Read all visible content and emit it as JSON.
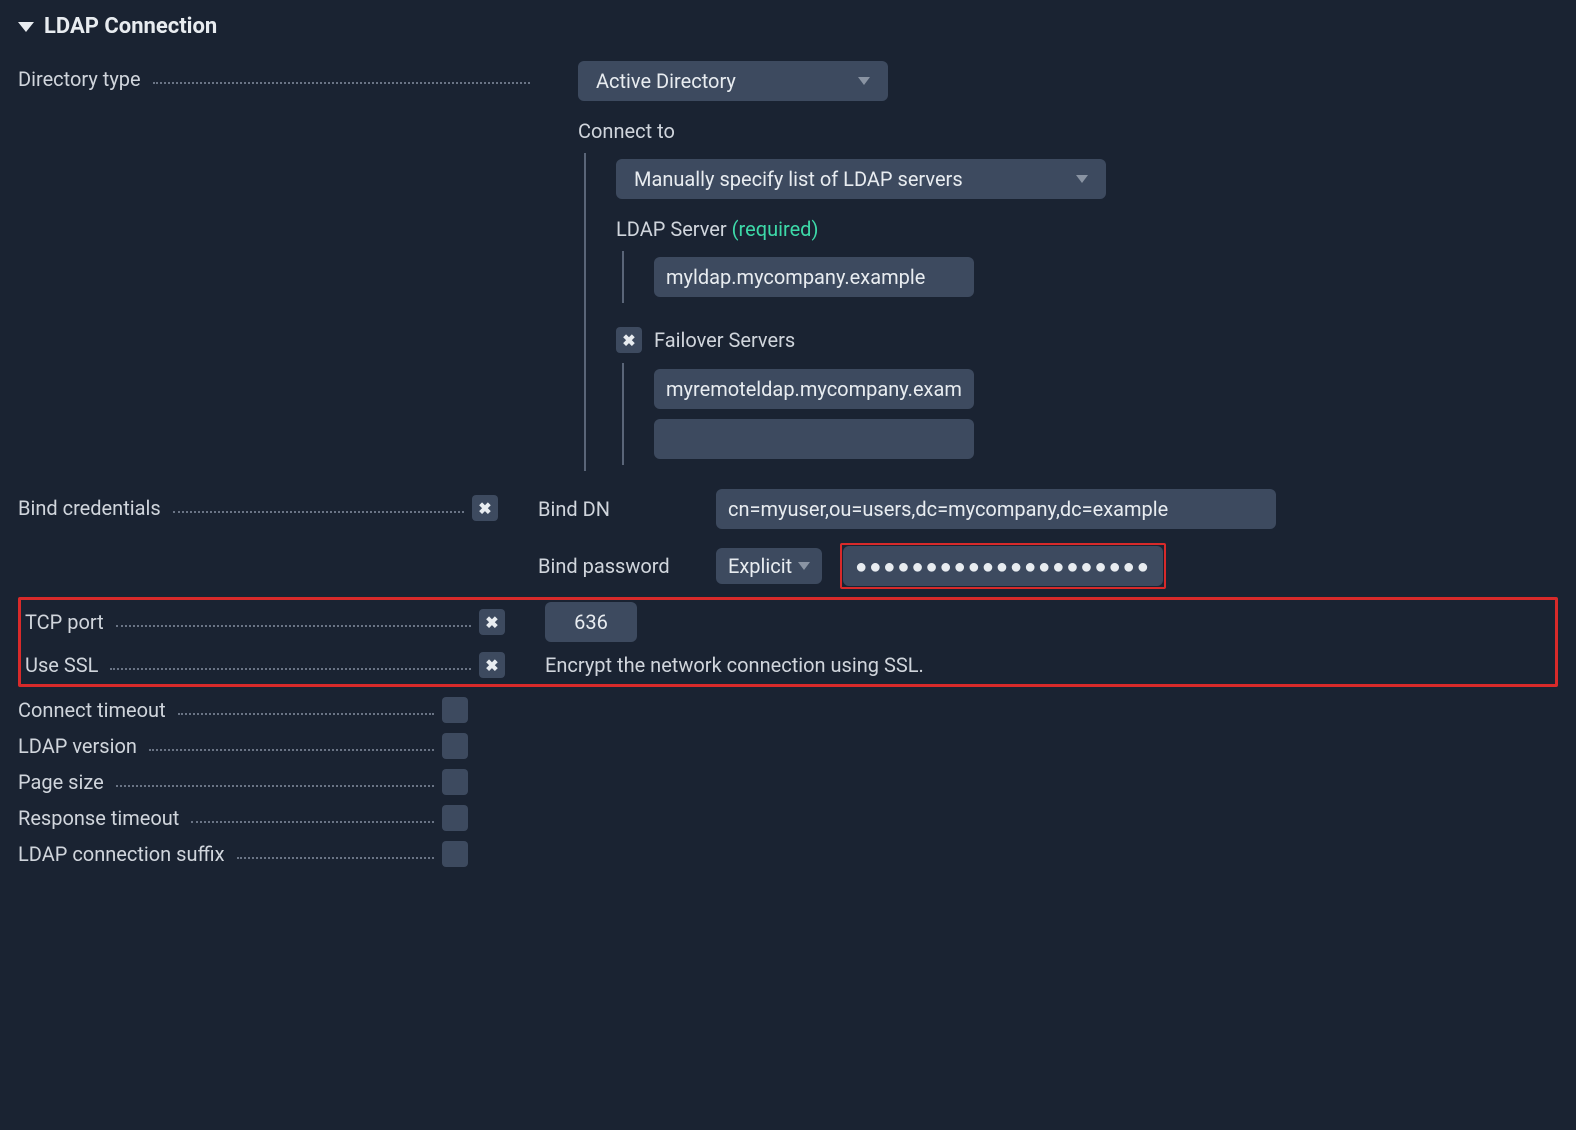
{
  "section": {
    "title": "LDAP Connection"
  },
  "directory_type": {
    "label": "Directory type",
    "value": "Active Directory",
    "connect_to": {
      "label": "Connect to",
      "value": "Manually specify list of LDAP servers"
    },
    "ldap_server": {
      "label": "LDAP Server",
      "required_text": "(required)",
      "value": "myldap.mycompany.example"
    },
    "failover": {
      "label": "Failover Servers",
      "values": [
        "myremoteldap.mycompany.example",
        ""
      ]
    }
  },
  "bind": {
    "label": "Bind credentials",
    "dn_label": "Bind DN",
    "dn_value": "cn=myuser,ou=users,dc=mycompany,dc=example",
    "password_label": "Bind password",
    "password_mode": "Explicit",
    "password_value": "●●●●●●●●●●●●●●●●●●●●●●"
  },
  "tcp_port": {
    "label": "TCP port",
    "value": "636"
  },
  "use_ssl": {
    "label": "Use SSL",
    "description": "Encrypt the network connection using SSL."
  },
  "connect_timeout": {
    "label": "Connect timeout"
  },
  "ldap_version": {
    "label": "LDAP version"
  },
  "page_size": {
    "label": "Page size"
  },
  "response_timeout": {
    "label": "Response timeout"
  },
  "conn_suffix": {
    "label": "LDAP connection suffix"
  }
}
